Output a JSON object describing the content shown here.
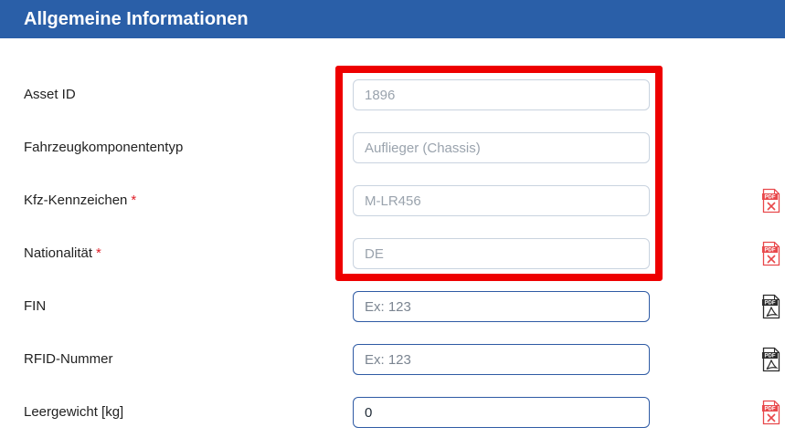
{
  "section": {
    "title": "Allgemeine Informationen"
  },
  "fields": [
    {
      "label": "Asset ID",
      "required": "",
      "value": "1896",
      "placeholder": ""
    },
    {
      "label": "Fahrzeugkomponententyp",
      "required": "",
      "value": "Auflieger (Chassis)",
      "placeholder": ""
    },
    {
      "label": "Kfz-Kennzeichen",
      "required": "*",
      "value": "M-LR456",
      "placeholder": "",
      "doc_icon": "pdf-missing-icon"
    },
    {
      "label": "Nationalität",
      "required": "*",
      "value": "DE",
      "placeholder": "",
      "doc_icon": "pdf-missing-icon"
    },
    {
      "label": "FIN",
      "required": "",
      "value": "",
      "placeholder": "Ex: 123",
      "doc_icon": "pdf-document-icon"
    },
    {
      "label": "RFID-Nummer",
      "required": "",
      "value": "",
      "placeholder": "Ex: 123",
      "doc_icon": "pdf-document-icon"
    },
    {
      "label": "Leergewicht [kg]",
      "required": "",
      "value": "0",
      "placeholder": "",
      "doc_icon": "pdf-missing-icon"
    }
  ],
  "icons": {
    "pdf_badge_text": "PDF"
  },
  "colors": {
    "header_bg": "#2a5fa8",
    "required_marker": "#e0202a",
    "highlight_border": "#ee0000",
    "editable_border": "#2e5aa4",
    "pdf_missing": "#e8484b",
    "pdf_document": "#2b2b2b"
  }
}
